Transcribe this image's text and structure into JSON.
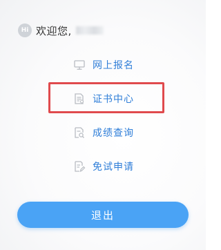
{
  "greeting": {
    "badge": "Hi",
    "text": "欢迎您,"
  },
  "menu": {
    "items": [
      {
        "label": "网上报名",
        "icon": "monitor-icon"
      },
      {
        "label": "证书中心",
        "icon": "certificate-document-icon",
        "highlighted": true
      },
      {
        "label": "成绩查询",
        "icon": "search-document-icon"
      },
      {
        "label": "免试申请",
        "icon": "edit-document-icon"
      }
    ]
  },
  "logout": {
    "label": "退出"
  },
  "colors": {
    "link": "#2f7ed8",
    "highlight_border": "#e04a4d",
    "button": "#4aa3f5",
    "icon": "#b8bcc2"
  }
}
